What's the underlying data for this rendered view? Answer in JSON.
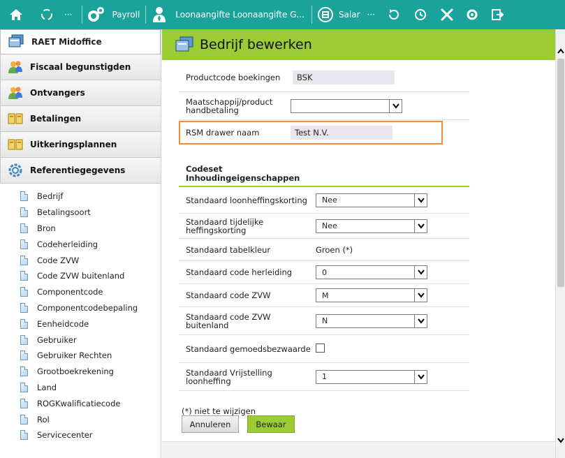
{
  "colors": {
    "topbar": "#1aa39a",
    "header_green": "#9ccc34",
    "highlight_border": "#f08a3c",
    "readonly_bg": "#ebe6ee"
  },
  "topbar": {
    "home_icon": "home-icon",
    "dots": "···",
    "payroll_label": "Payroll",
    "loonaangifte_label": "Loonaangifte Loonaangifte G...",
    "salar_label": "Salar",
    "dots2": "···"
  },
  "sidebar": {
    "header_title": "RAET Midoffice",
    "groups": [
      {
        "label": "Fiscaal begunstigden",
        "icon": "people-icon"
      },
      {
        "label": "Ontvangers",
        "icon": "people-icon"
      },
      {
        "label": "Betalingen",
        "icon": "book-icon"
      },
      {
        "label": "Uitkeringsplannen",
        "icon": "book-icon"
      },
      {
        "label": "Referentiegegevens",
        "icon": "gear-icon"
      }
    ],
    "ref_items": [
      "Bedrijf",
      "Betalingsoort",
      "Bron",
      "Codeherleiding",
      "Code ZVW",
      "Code ZVW buitenland",
      "Componentcode",
      "Componentcodebepaling",
      "Eenheidcode",
      "Gebruiker",
      "Gebruiker Rechten",
      "Grootboekrekening",
      "Land",
      "ROGKwalificatiecode",
      "Rol",
      "Servicecenter"
    ]
  },
  "main": {
    "title": "Bedrijf bewerken",
    "productcode_label": "Productcode boekingen",
    "productcode_value": "BSK",
    "maatschappij_label": "Maatschappij/product handbetaling",
    "maatschappij_value": "",
    "rsm_label": "RSM drawer naam",
    "rsm_value": "Test N.V.",
    "section_title": "Codeset Inhoudingeigenschappen",
    "rows": {
      "loonheffingskorting_label": "Standaard loonheffingskorting",
      "loonheffingskorting_value": "Nee",
      "tijdelijke_label": "Standaard tijdelijke heffingskorting",
      "tijdelijke_value": "Nee",
      "tabelkleur_label": "Standaard tabelkleur",
      "tabelkleur_value": "Groen (*)",
      "herleiding_label": "Standaard code herleiding",
      "herleiding_value": "0",
      "zvw_label": "Standaard code ZVW",
      "zvw_value": "M",
      "zvw_buitenland_label": "Standaard code ZVW buitenland",
      "zvw_buitenland_value": "N",
      "gemoedsbezwaarde_label": "Standaard gemoedsbezwaarde",
      "vrijstelling_label": "Standaard Vrijstelling loonheffing",
      "vrijstelling_value": "1"
    },
    "note": "(*) niet te wijzigen",
    "cancel_label": "Annuleren",
    "save_label": "Bewaar"
  }
}
